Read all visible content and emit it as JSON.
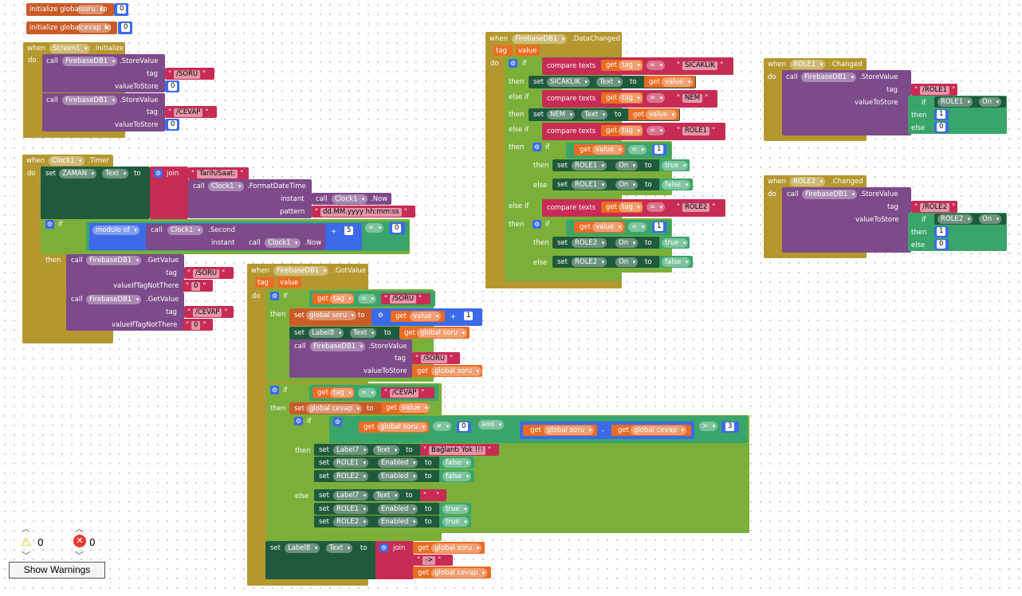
{
  "globals": {
    "init_label": "initialize global",
    "to": "to",
    "soru_name": "soru",
    "soru_val": "0",
    "cevap_name": "cevap",
    "cevap_val": "0"
  },
  "kw": {
    "when": "when",
    "do": "do",
    "call": "call",
    "set": "set",
    "if": "if",
    "then": "then",
    "else": "else",
    "elseif": "else if",
    "get": "get",
    "join": "join",
    "to": "to",
    "tag": "tag",
    "value": "value",
    "and": "and",
    "modulo": "modulo of",
    "instant": "instant",
    "pattern": "pattern",
    "compare": "compare texts",
    "valueToStore": "valueToStore",
    "valueIfTagNotThere": "valueIfTagNotThere"
  },
  "comp": {
    "screen1": "Screen1",
    "initialize": ".Initialize",
    "firebase": "FirebaseDB1",
    "storeValue": ".StoreValue",
    "getValue": ".GetValue",
    "gotValue": ".GotValue",
    "dataChanged": ".DataChanged",
    "clock": "Clock1",
    "timer": ".Timer",
    "formatDT": ".FormatDateTime",
    "now": ".Now",
    "second": ".Second",
    "zaman": "ZAMAN",
    "text": "Text",
    "label8": "Label8",
    "label7": "Label7",
    "sicaklik": "SICAKLIK",
    "nem": "NEM",
    "role1": "ROLE1",
    "role2": "ROLE2",
    "on": "On",
    "enabled": "Enabled",
    "changed": ".Changed"
  },
  "str": {
    "soru": "/SORU",
    "cevap": "/CEVAP",
    "role1": "/ROLE1",
    "role2": "/ROLE2",
    "sicaklik": "SICAKLIK",
    "nem": "NEM",
    "role1k": "ROLE1",
    "role2k": "ROLE2",
    "tarih": "Tarih/Saat:",
    "pattern": "dd.MM.yyyy hh:mm:ss",
    "zero": "0",
    "baglanti": "Bağlantı Yok !!!",
    "empty": "",
    "arrow": "->"
  },
  "ops": {
    "eq": "=",
    "neq": "≠",
    "plus": "+",
    "minus": "-",
    "gt": ">",
    "div": "÷"
  },
  "nums": {
    "zero": "0",
    "one": "1",
    "five": "5",
    "three": "3"
  },
  "bool": {
    "true": "true",
    "false": "false"
  },
  "vars": {
    "globalSoru": "global soru",
    "globalCevap": "global cevap",
    "tag": "tag",
    "value": "value"
  },
  "warnings": {
    "warn_count": "0",
    "error_count": "0",
    "button": "Show Warnings"
  },
  "colors": {
    "event": "#b5972f",
    "procedure": "#7d4a8a",
    "math": "#3d6ae8",
    "text": "#c72c54",
    "setter": "#1f5a3c",
    "control": "#7ab03a",
    "variable": "#ea6c24",
    "global": "#c95b27",
    "logic": "#3aa56b"
  }
}
